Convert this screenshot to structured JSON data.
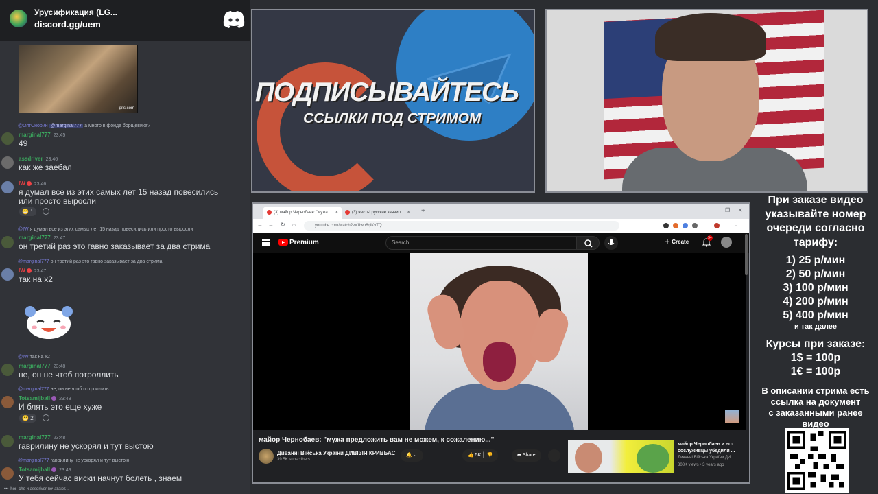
{
  "chat": {
    "server_title": "Урусификация (LG...",
    "invite": "discord.gg/uem",
    "gif_tag": "gifs.com",
    "messages": [
      {
        "reply_name": "@ОлгСнорин",
        "reply_mention": "@marginal777",
        "reply_text": "а много в фонде борщевика?",
        "user": "marginal777",
        "user_color": "#3ba55d",
        "time": "23:45",
        "text": "49"
      },
      {
        "user": "assdriver",
        "user_color": "#3ba55d",
        "time": "23:46",
        "text": "как же заебал"
      },
      {
        "user": "IW",
        "user_color": "#ed4245",
        "time": "23:46",
        "text": "я думал все из этих самых лет 15 назад повесились",
        "text2": "или просто выросли",
        "reaction_count": "1"
      },
      {
        "reply_name": "@IW",
        "reply_text": "я думал все из этих самых лет 15 назад повесились или просто выросли",
        "user": "marginal777",
        "user_color": "#3ba55d",
        "time": "23:47",
        "text": "он третий раз это гавно заказывает за два стрима"
      },
      {
        "reply_name": "@marginal777",
        "reply_text": "он третий раз это гавно заказывает за два стрима",
        "user": "IW",
        "user_color": "#ed4245",
        "time": "23:47",
        "text": "так на x2"
      },
      {
        "reply_name": "@IW",
        "reply_text": "так на x2",
        "user": "marginal777",
        "user_color": "#3ba55d",
        "time": "23:48",
        "text": "не, он не чтоб потроллить"
      },
      {
        "reply_name": "@marginal777",
        "reply_text": "не, он не чтоб потроллить",
        "user": "Totsamijball",
        "user_color": "#3ba55d",
        "time": "23:48",
        "text": "И блять это еще хуже",
        "reaction_count": "2"
      },
      {
        "user": "marginal777",
        "user_color": "#3ba55d",
        "time": "23:48",
        "text": "гаврилину не ускорял и тут выстою"
      },
      {
        "reply_name": "@marginal777",
        "reply_text": "гаврилину не ускорял и тут выстою",
        "user": "Totsamijball",
        "user_color": "#3ba55d",
        "time": "23:49",
        "text": "У тебя сейчас виски начнут болеть , знаем"
      }
    ],
    "typing": "lhor_che и assdriver печатают..."
  },
  "promo": {
    "line1": "ПОДПИСЫВАЙТЕСЬ",
    "line2": "ССЫЛКИ ПОД СТРИМОМ"
  },
  "browser": {
    "tabs": [
      {
        "label": "(3) майор Чернобаев: \"мужа ...",
        "active": true
      },
      {
        "label": "(3) жесть! русские заявил...",
        "active": false
      }
    ],
    "url": "youtube.com/watch?v=1Iwo6qiKvTQ"
  },
  "youtube": {
    "brand": "Premium",
    "search_placeholder": "Search",
    "create_label": "Create",
    "notif_count": "9+",
    "video_title": "майор Чернобаев: \"мужа предложить вам не можем, к сожалению...\"",
    "channel_name": "Диванні Війська України ДИВІЗІЯ КРИВБАС",
    "subscribers": "39.5K subscribers",
    "likes": "5K",
    "share_label": "Share",
    "more_label": "...",
    "rec_title": "майор Чернобаев и его сослуживцы убедили ...",
    "rec_channel": "Диванні Війська України ДИ...",
    "rec_meta": "308K views • 3 years ago"
  },
  "info": {
    "head": [
      "При заказе видео",
      "указывайте номер",
      "очереди согласно",
      "тарифу:"
    ],
    "tariffs": [
      "1) 25 р/мин",
      "2) 50 р/мин",
      "3) 100 р/мин",
      "4) 200 р/мин",
      "5) 400 р/мин"
    ],
    "etc": "и так далее",
    "courses": [
      "Курсы при заказе:",
      "1$ = 100р",
      "1€ = 100р"
    ],
    "desc": [
      "В описании стрима есть",
      "ссылка на документ",
      "с заказанными ранее",
      "видео"
    ]
  }
}
